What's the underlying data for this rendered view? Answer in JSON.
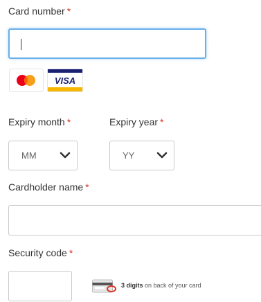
{
  "card_number": {
    "label": "Card number",
    "required_mark": "*",
    "value": "",
    "accepted_cards": [
      "mastercard-icon",
      "visa-icon"
    ],
    "visa_text": "VISA"
  },
  "expiry_month": {
    "label": "Expiry month",
    "required_mark": "*",
    "selected": "MM"
  },
  "expiry_year": {
    "label": "Expiry year",
    "required_mark": "*",
    "selected": "YY"
  },
  "cardholder_name": {
    "label": "Cardholder name",
    "required_mark": "*",
    "value": ""
  },
  "security_code": {
    "label": "Security code",
    "required_mark": "*",
    "value": "",
    "hint_bold": "3 digits",
    "hint_rest": " on back of your card"
  },
  "colors": {
    "required": "#d9342b",
    "focus_border": "#66afe9",
    "visa_blue": "#1a1f71",
    "visa_gold": "#f7b600",
    "mc_red": "#eb001b",
    "mc_orange": "#f79e1b"
  }
}
